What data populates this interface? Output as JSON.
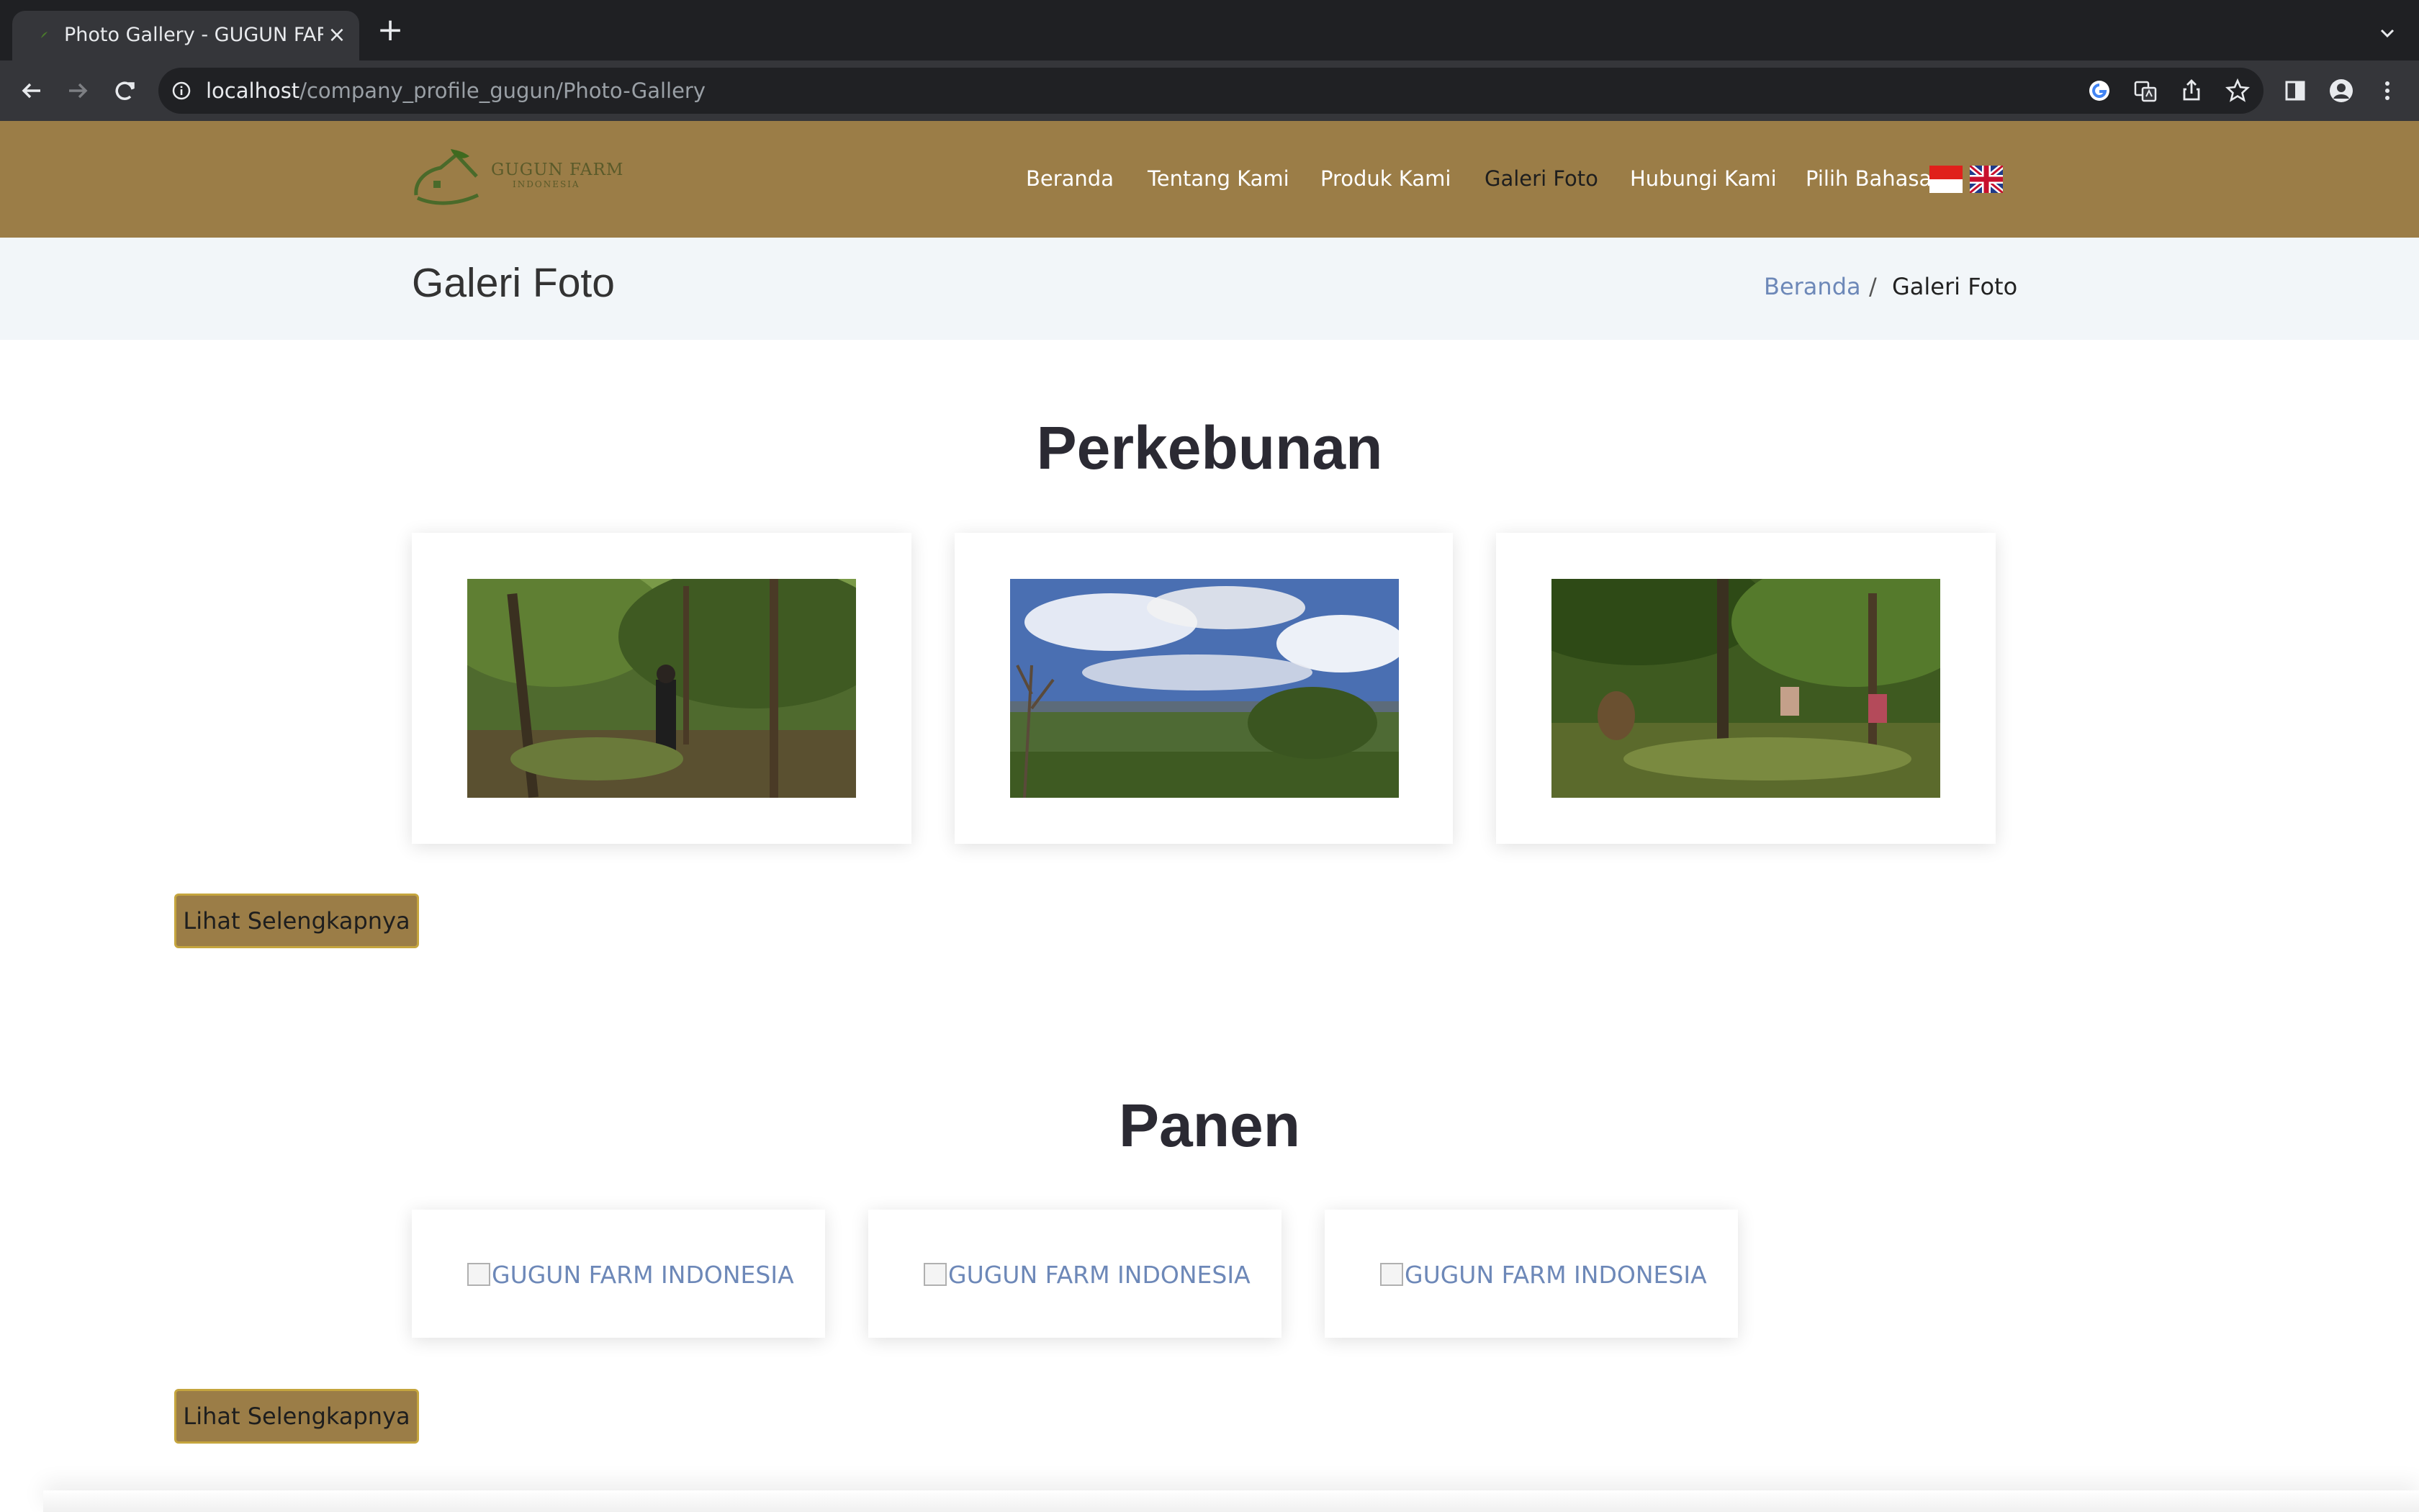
{
  "browser": {
    "tab_title": "Photo Gallery - GUGUN FARM",
    "close_icon": "×",
    "new_tab_icon": "+",
    "url_host": "localhost",
    "url_path": "/company_profile_gugun/Photo-Gallery"
  },
  "header": {
    "logo_text": "GUGUN FARM",
    "logo_subtext": "INDONESIA",
    "menu": [
      {
        "label": "Beranda"
      },
      {
        "label": "Tentang Kami"
      },
      {
        "label": "Produk Kami"
      },
      {
        "label": "Galeri Foto"
      },
      {
        "label": "Hubungi Kami"
      },
      {
        "label": "Pilih Bahasa"
      }
    ],
    "active_menu": "Galeri Foto"
  },
  "title_bar": {
    "title": "Galeri Foto",
    "breadcrumb_home": "Beranda",
    "breadcrumb_separator": "/",
    "breadcrumb_current": "Galeri Foto"
  },
  "sections": [
    {
      "title": "Perkebunan",
      "photos": [
        "forest-man-photo",
        "landscape-sky-photo",
        "farm-workers-photo"
      ],
      "more_label": "Lihat Selengkapnya"
    },
    {
      "title": "Panen",
      "broken_alt": [
        "GUGUN FARM INDONESIA",
        "GUGUN FARM INDONESIA",
        "GUGUN FARM INDONESIA"
      ],
      "more_label": "Lihat Selengkapnya"
    }
  ],
  "colors": {
    "header_bg": "#9b7d47",
    "title_bar_bg": "#f2f6f9",
    "link": "#6d88b8",
    "button_border": "#c5a53e"
  }
}
